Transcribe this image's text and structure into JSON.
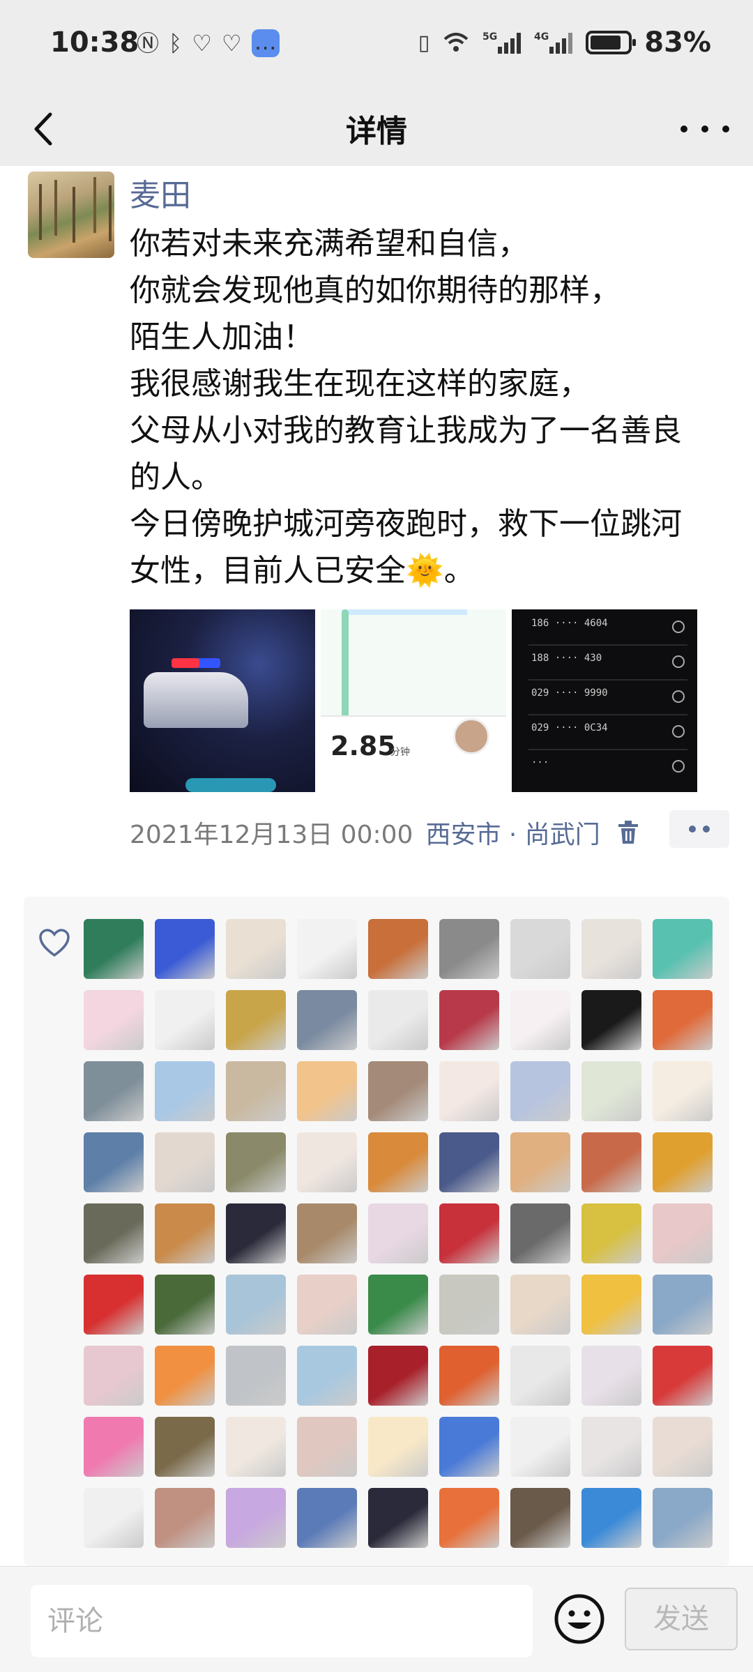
{
  "status_bar": {
    "time": "10:38",
    "network_5g": "5G",
    "network_4g": "4G",
    "battery_percent": "83%",
    "battery_level": 0.83,
    "icons_left": [
      "nfc-icon",
      "bluetooth-icon",
      "app-icon",
      "app-icon",
      "message-icon"
    ],
    "icons_right": [
      "vibrate-icon",
      "wifi-icon",
      "signal-5g-icon",
      "signal-4g-icon",
      "battery-icon"
    ]
  },
  "nav": {
    "title": "详情",
    "back_icon": "chevron-left-icon",
    "more_icon": "more-icon"
  },
  "post": {
    "username": "麦田",
    "lines": [
      "你若对未来充满希望和自信，",
      "你就会发现他真的如你期待的那样，",
      "陌生人加油！",
      "我很感谢我生在现在这样的家庭，",
      "父母从小对我的教育让我成为了一名善良",
      "的人。",
      "今日傍晚护城河旁夜跑时，救下一位跳河",
      "女性，目前人已安全🌞。"
    ],
    "photos": [
      {
        "name": "night-police-photo"
      },
      {
        "name": "running-app-screenshot",
        "pace": "2.85",
        "pace_unit": "分钟"
      },
      {
        "name": "call-log-screenshot"
      }
    ],
    "date": "2021年12月13日 00:00",
    "location": "西安市 · 尚武门",
    "delete_icon": "trash-icon",
    "comment_icon": "comment-more-icon"
  },
  "likes": {
    "heart_icon": "heart-icon",
    "count_rows": 9,
    "colors": [
      "#2f7d5b",
      "#3b5bd6",
      "#e9dfd3",
      "#f2f2f2",
      "#c86f3a",
      "#8a8a8a",
      "#d9d9d9",
      "#e8e2dc",
      "#58c1b0",
      "#f3d6e0",
      "#f0f0f0",
      "#c9a54a",
      "#7a8aa0",
      "#eaeaea",
      "#b83a4a",
      "#f6f0f2",
      "#1a1a1a",
      "#e06a3a",
      "#7f8f9a",
      "#a8c8e6",
      "#c9b9a0",
      "#f2c38a",
      "#a48a78",
      "#f4e8e4",
      "#b7c4e0",
      "#dfe6d6",
      "#f5ede2",
      "#5d7fa8",
      "#e2d8d0",
      "#8a8a6a",
      "#f0e6e0",
      "#d98a3a",
      "#4a5a8a",
      "#e0b080",
      "#c86a4a",
      "#e0a030",
      "#6a6a5a",
      "#c98a4a",
      "#2a2a3a",
      "#a88a6a",
      "#e8d8e4",
      "#c8303a",
      "#6a6a6a",
      "#d8c040",
      "#e8c8c8",
      "#d83030",
      "#4a6a3a",
      "#a8c4d8",
      "#e8d0c8",
      "#3a8a4a",
      "#c8c8c0",
      "#e8d8c8",
      "#f0c040",
      "#8aa8c8",
      "#e8c8d0",
      "#f09040",
      "#c0c4c8",
      "#a8c8e0",
      "#a8202a",
      "#e06030",
      "#e8e8e8",
      "#e8e0e8",
      "#d83a3a",
      "#f07ab0",
      "#7a6a4a",
      "#f0e8e0",
      "#e0c8c0",
      "#f8e8c8",
      "#4a7ad8",
      "#f0f0f0",
      "#e8e4e4",
      "#e8dcd4",
      "#f0f0f0",
      "#c09080",
      "#c8a8e0",
      "#5a7ab8",
      "#2a2a3a",
      "#e8703a",
      "#6a5a4a",
      "#3a8ad8",
      "#8aa8c8"
    ]
  },
  "bottom": {
    "comment_placeholder": "评论",
    "emoji_icon": "emoji-icon",
    "send_label": "发送"
  }
}
